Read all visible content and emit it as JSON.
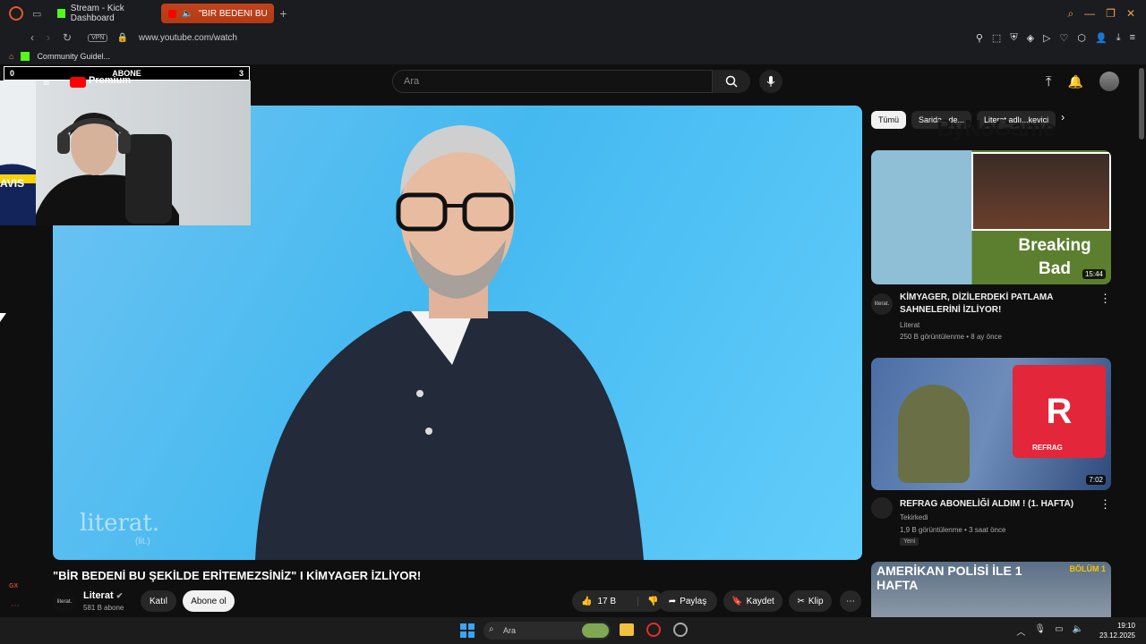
{
  "browser": {
    "tabs": [
      {
        "label": "Stream - Kick Dashboard"
      },
      {
        "label": "\"BİR BEDENİ BU ŞEKİ"
      }
    ],
    "url": "www.youtube.com/watch",
    "vpn": "VPN",
    "bookmark": "Community Guidel..."
  },
  "overlay": {
    "left_score": "0",
    "label": "ABONE",
    "right_score": "3",
    "jersey_text": "AVIS"
  },
  "youtube": {
    "premium": "Premium",
    "search_placeholder": "Ara",
    "video_title": "\"BİR BEDENİ BU ŞEKİLDE ERİTEMEZSİNİZ\" I KİMYAGER İZLİYOR!",
    "watermark": "literat.",
    "watermark_sub": "(lit.)",
    "channel": {
      "name": "Literat",
      "subs": "581 B abone",
      "logo": "literat."
    },
    "buttons": {
      "join": "Katıl",
      "subscribe": "Abone ol",
      "likes": "17 B",
      "share": "Paylaş",
      "save": "Kaydet",
      "clip": "Klip"
    }
  },
  "chips": [
    "Tümü",
    "Sarida...de...",
    "Literat adlı...kevici"
  ],
  "sidebar_watermark": "ByNoGame",
  "recommendations": [
    {
      "title": "KİMYAGER, DİZİLERDEKİ PATLAMA SAHNELERİNİ İZLİYOR!",
      "channel": "Literat",
      "meta": "250 B görüntülenme • 8 ay önce",
      "duration": "15:44",
      "thumb_text": "Breaking Bad",
      "logo": "literat."
    },
    {
      "title": "REFRAG ABONELİĞİ ALDIM ! (1. HAFTA)",
      "channel": "Tekirkedi",
      "meta": "1,9 B görüntülenme • 3 saat önce",
      "duration": "7:02",
      "thumb_text": "REFRAG",
      "badge": "Yeni"
    },
    {
      "thumb_text": "AMERİKAN POLİSİ İLE 1 HAFTA",
      "thumb_badge": "BÖLÜM 1"
    }
  ],
  "taskbar": {
    "search": "Ara",
    "time": "19:10",
    "date": "23.12.2025"
  },
  "gx": "GX",
  "colors": {
    "youtube_red": "#ff0000",
    "kick_green": "#53fc18",
    "opera_red": "#e2582b"
  }
}
